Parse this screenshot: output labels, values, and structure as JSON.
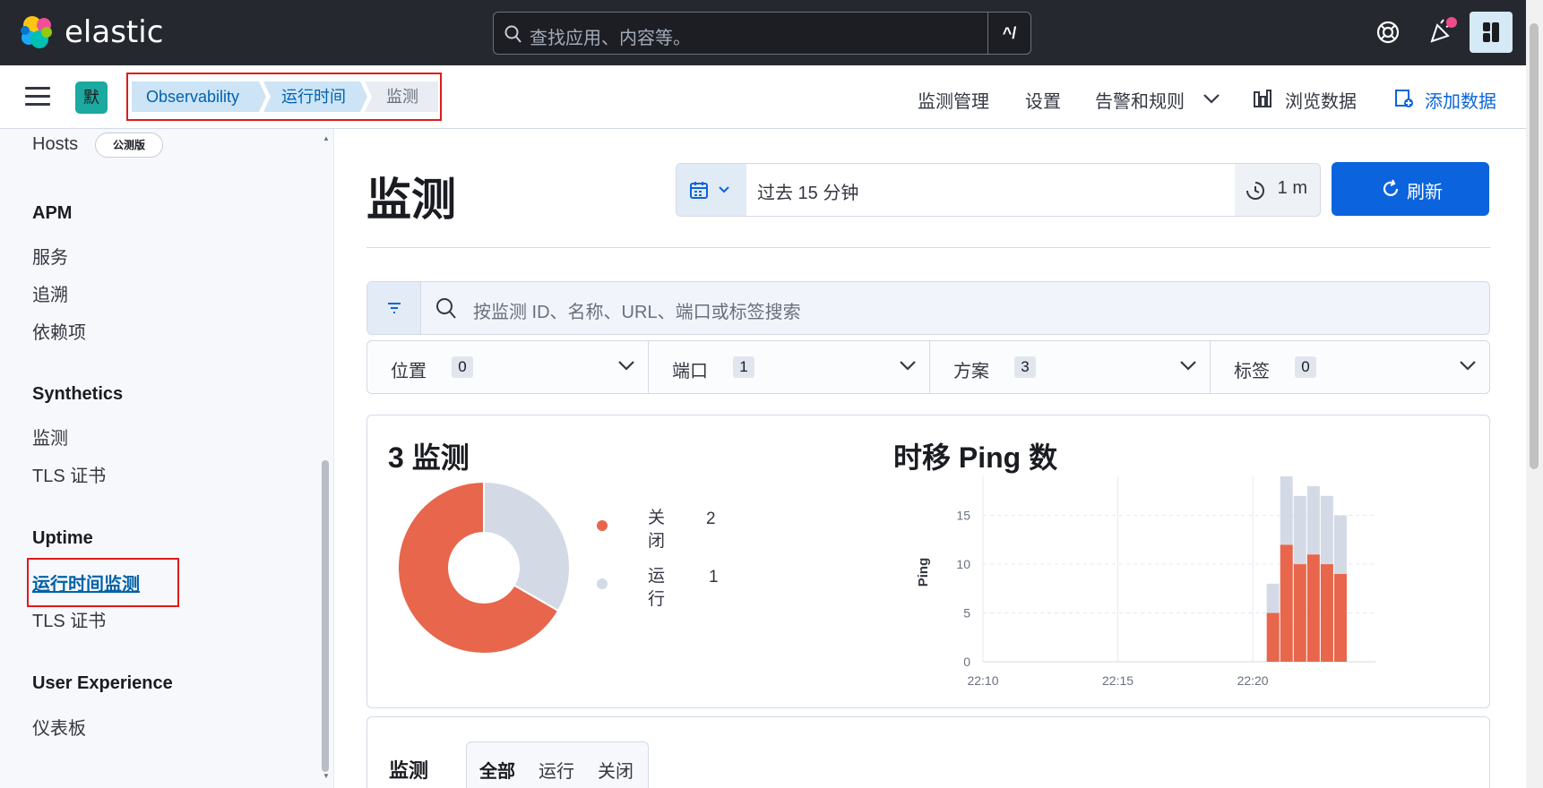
{
  "topbar": {
    "brand": "elastic",
    "search_placeholder": "查找应用、内容等。",
    "search_shortcut": "^/"
  },
  "header": {
    "space_avatar": "默",
    "breadcrumbs": [
      "Observability",
      "运行时间",
      "监测"
    ],
    "nav": {
      "manage": "监测管理",
      "settings": "设置",
      "alerts": "告警和规则",
      "explore": "浏览数据",
      "add_data": "添加数据"
    }
  },
  "sidebar": {
    "hosts": "Hosts",
    "hosts_badge": "公测版",
    "apm_title": "APM",
    "apm_items": [
      "服务",
      "追溯",
      "依赖项"
    ],
    "synthetics_title": "Synthetics",
    "synthetics_items": [
      "监测",
      "TLS 证书"
    ],
    "uptime_title": "Uptime",
    "uptime_items": [
      "运行时间监测",
      "TLS 证书"
    ],
    "ux_title": "User Experience",
    "ux_items": [
      "仪表板"
    ]
  },
  "main": {
    "title": "监测",
    "date_range": "过去 15 分钟",
    "refresh_interval": "1 m",
    "refresh_label": "刷新",
    "search_placeholder": "按监测 ID、名称、URL、端口或标签搜索",
    "filters": [
      {
        "label": "位置",
        "count": "0"
      },
      {
        "label": "端口",
        "count": "1"
      },
      {
        "label": "方案",
        "count": "3"
      },
      {
        "label": "标签",
        "count": "0"
      }
    ],
    "summary": {
      "title": "3 监测",
      "legend": [
        {
          "label": "关闭",
          "value": "2",
          "color": "#e7664c"
        },
        {
          "label": "运行",
          "value": "1",
          "color": "#d3dae6"
        }
      ]
    },
    "ping_chart_title": "时移 Ping 数",
    "monitors_title": "监测",
    "monitor_tabs": [
      "全部",
      "运行",
      "关闭"
    ]
  },
  "chart_data": [
    {
      "type": "pie",
      "title": "3 监测",
      "categories": [
        "关闭",
        "运行"
      ],
      "values": [
        2,
        1
      ],
      "colors": [
        "#e7664c",
        "#d3dae6"
      ]
    },
    {
      "type": "bar",
      "title": "时移 Ping 数",
      "ylabel": "Ping",
      "ylim": [
        0,
        19
      ],
      "yticks": [
        0,
        5,
        10,
        15
      ],
      "xticks": [
        "22:10",
        "22:15",
        "22:20"
      ],
      "x": [
        "22:20:45",
        "22:21:15",
        "22:21:45",
        "22:22:15",
        "22:22:45",
        "22:23:15",
        "22:23:45"
      ],
      "series": [
        {
          "name": "关闭",
          "color": "#e7664c",
          "values": [
            5,
            12,
            10,
            11,
            10,
            9
          ]
        },
        {
          "name": "运行",
          "color": "#d3dae6",
          "values": [
            3,
            7,
            7,
            7,
            7,
            6
          ]
        }
      ]
    }
  ]
}
